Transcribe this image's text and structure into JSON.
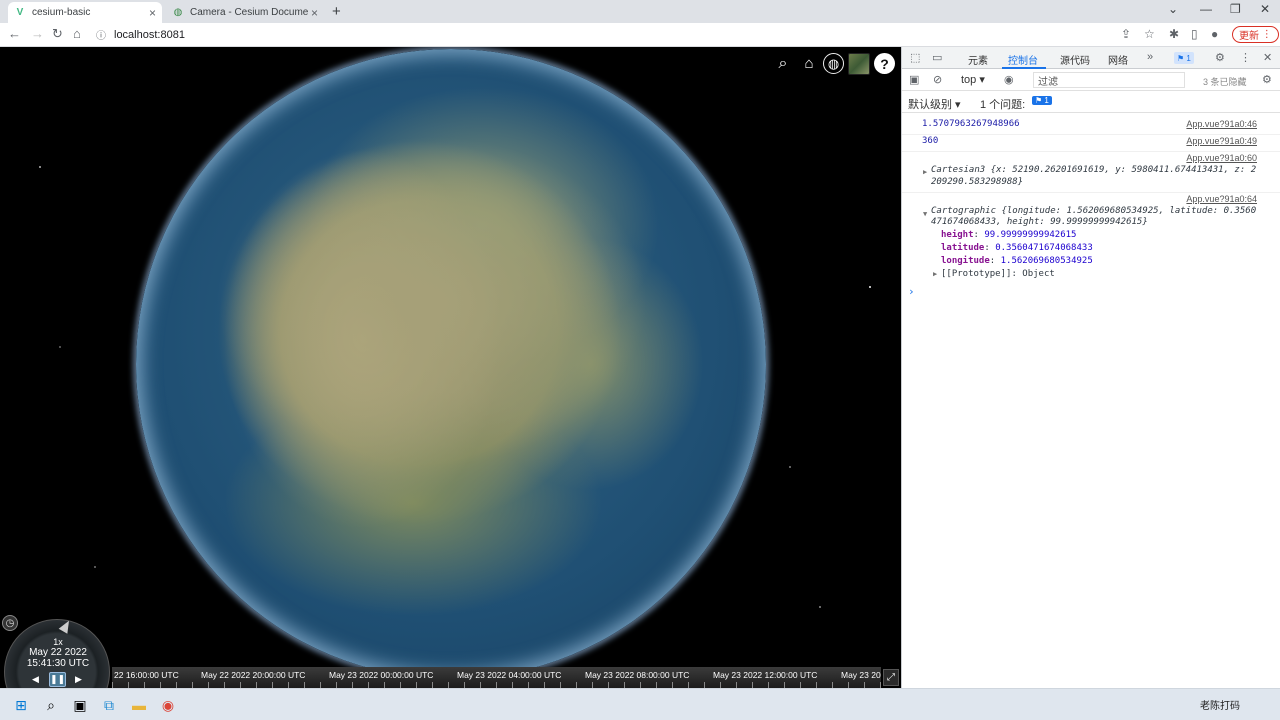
{
  "browser": {
    "tabs": [
      {
        "title": "cesium-basic",
        "favicon": "vue-icon",
        "active": true
      },
      {
        "title": "Camera - Cesium Documentati",
        "favicon": "globe-icon",
        "active": false
      }
    ],
    "url": "localhost:8081",
    "update_label": "更新"
  },
  "viewer": {
    "toolbar": [
      "search-icon",
      "home-icon",
      "globe-icon",
      "layer-picker",
      "help-icon"
    ],
    "help_label": "?",
    "animation": {
      "speed": "1x",
      "date": "May 22 2022",
      "time": "15:41:30 UTC"
    },
    "timeline": {
      "labels": [
        "22 16:00:00 UTC",
        "May 22 2022 20:00:00 UTC",
        "May 23 2022 00:00:00 UTC",
        "May 23 2022 04:00:00 UTC",
        "May 23 2022 08:00:00 UTC",
        "May 23 2022 12:00:00 UTC",
        "May 23 20"
      ]
    }
  },
  "devtools": {
    "tabs": [
      "元素",
      "控制台",
      "源代码",
      "网络"
    ],
    "active_tab": "控制台",
    "badge": "1",
    "context": "top",
    "filter_placeholder": "过滤",
    "hidden_count": "3 条已隐藏",
    "level": "默认级别",
    "issues": "1 个问题:",
    "issues_badge": "1",
    "console": [
      {
        "msg": "1.5707963267948966",
        "src": "App.vue?91a0:46"
      },
      {
        "msg": "360",
        "src": "App.vue?91a0:49"
      },
      {
        "src": "App.vue?91a0:60",
        "obj_line1": "Cartesian3 {x: 52190.26201691619, y: 5980411.674413431, z: 2",
        "obj_line2": "209290.583298988}"
      },
      {
        "src": "App.vue?91a0:64",
        "obj_line1": "Cartographic {longitude: 1.562069680534925, latitude: 0.3560",
        "obj_line2": "471674068433, height: 99.99999999942615}"
      }
    ],
    "props": [
      {
        "key": "height",
        "value": "99.99999999942615"
      },
      {
        "key": "latitude",
        "value": "0.3560471674068433"
      },
      {
        "key": "longitude",
        "value": "1.562069680534925"
      }
    ],
    "prototype": "[[Prototype]]: Object",
    "prompt": "›"
  },
  "taskbar": {
    "apps": [
      "windows-icon",
      "search-icon",
      "task-view-icon",
      "vscode-icon",
      "folder-icon",
      "chrome-icon"
    ],
    "brand": "老陈打码"
  }
}
